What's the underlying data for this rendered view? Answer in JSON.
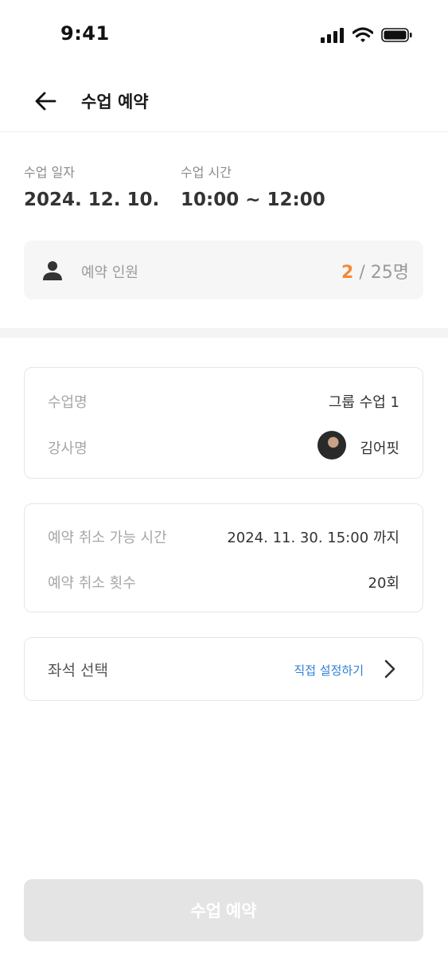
{
  "status_bar": {
    "time": "9:41"
  },
  "header": {
    "title": "수업 예약",
    "back_icon": "arrow-left-icon"
  },
  "class_info": {
    "date_label": "수업 일자",
    "date_value": "2024. 12. 10.",
    "time_label": "수업 시간",
    "time_value": "10:00 ~ 12:00"
  },
  "capacity": {
    "label": "예약 인원",
    "current": "2",
    "separator": "/",
    "total": "25명",
    "icon": "person-icon",
    "accent_color": "#f08a3a"
  },
  "class_card": {
    "name_label": "수업명",
    "name_value": "그룹 수업 1",
    "instructor_label": "강사명",
    "instructor_value": "김어핏"
  },
  "cancel_card": {
    "deadline_label": "예약 취소 가능 시간",
    "deadline_value": "2024. 11. 30. 15:00 까지",
    "count_label": "예약 취소 횟수",
    "count_value": "20회"
  },
  "seat_card": {
    "label": "좌석 선택",
    "link": "직접 설정하기",
    "link_color": "#2f7dd6",
    "icon": "chevron-right-icon"
  },
  "submit_button": {
    "label": "수업 예약",
    "state": "disabled"
  }
}
